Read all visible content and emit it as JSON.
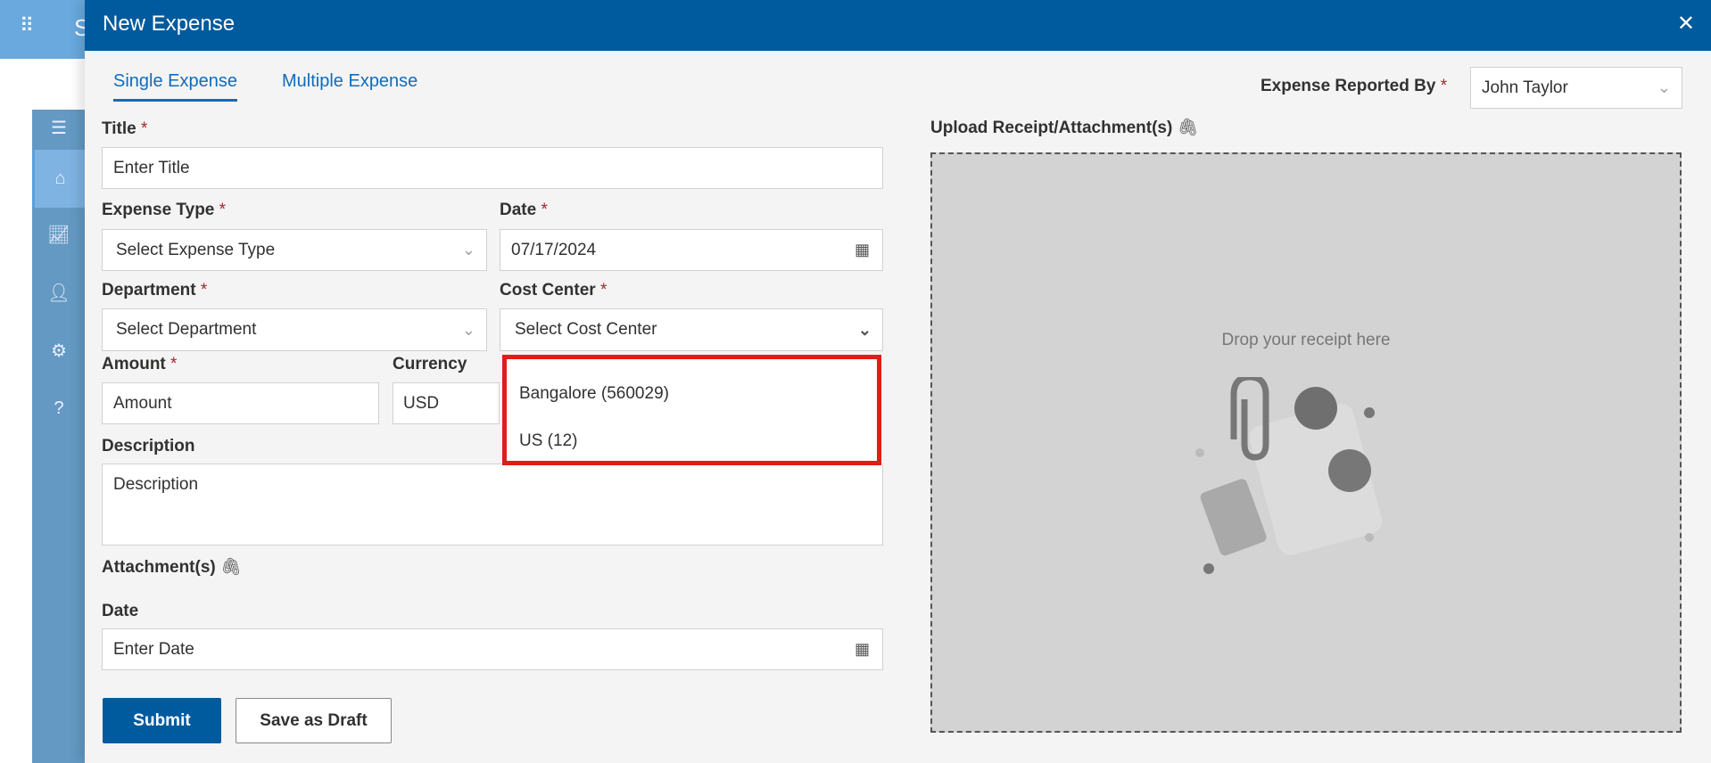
{
  "app": {
    "name_partial": "S",
    "waffle_icon": "waffle-icon"
  },
  "sidebar": {
    "items": [
      "menu",
      "home",
      "analytics",
      "user-settings",
      "settings",
      "help"
    ]
  },
  "dialog": {
    "title": "New Expense",
    "close": "✕"
  },
  "tabs": [
    {
      "label": "Single Expense",
      "active": true
    },
    {
      "label": "Multiple Expense",
      "active": false
    }
  ],
  "reported_by": {
    "label": "Expense Reported By",
    "required": "*",
    "value": "John Taylor"
  },
  "form": {
    "title": {
      "label": "Title",
      "required": "*",
      "placeholder": "Enter Title"
    },
    "expense_type": {
      "label": "Expense Type",
      "required": "*",
      "placeholder": "Select Expense Type"
    },
    "date": {
      "label": "Date",
      "required": "*",
      "value": "07/17/2024"
    },
    "department": {
      "label": "Department",
      "required": "*",
      "placeholder": "Select Department"
    },
    "cost_center": {
      "label": "Cost Center",
      "required": "*",
      "placeholder": "Select Cost Center",
      "options": [
        "Bangalore (560029)",
        "US (12)"
      ]
    },
    "amount": {
      "label": "Amount",
      "required": "*",
      "placeholder": "Amount"
    },
    "currency": {
      "label": "Currency",
      "value": "USD"
    },
    "description": {
      "label": "Description",
      "placeholder": "Description"
    },
    "attachments": {
      "label": "Attachment(s)"
    },
    "date2": {
      "label": "Date",
      "placeholder": "Enter Date"
    },
    "submit": "Submit",
    "draft": "Save as Draft"
  },
  "upload": {
    "label": "Upload Receipt/Attachment(s)",
    "drop_text": "Drop your receipt here"
  },
  "colors": {
    "header": "#005a9e",
    "accent": "#0f6cbd",
    "highlight": "#e21b1b"
  }
}
